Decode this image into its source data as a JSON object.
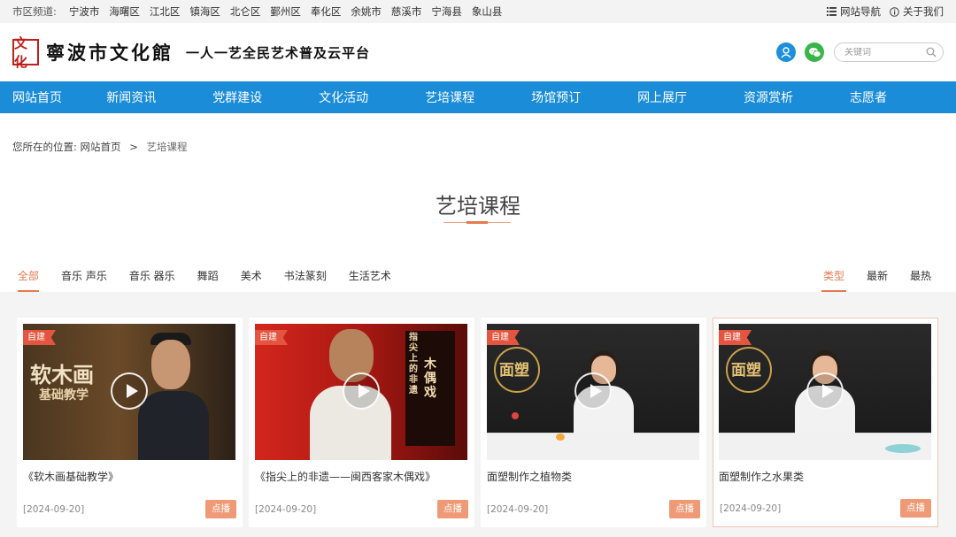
{
  "topbar": {
    "channel_label": "市区频道:",
    "cities": [
      "宁波市",
      "海曙区",
      "江北区",
      "镇海区",
      "北仑区",
      "鄞州区",
      "奉化区",
      "余姚市",
      "慈溪市",
      "宁海县",
      "象山县"
    ],
    "site_nav": "网站导航",
    "about": "关于我们"
  },
  "header": {
    "logo_mark": "文化",
    "logo_name": "寧波市文化館",
    "slogan": "一人一艺全民艺术普及云平台",
    "search_placeholder": "关键词"
  },
  "nav": [
    "网站首页",
    "新闻资讯",
    "党群建设",
    "文化活动",
    "艺培课程",
    "场馆预订",
    "网上展厅",
    "资源赏析",
    "志愿者"
  ],
  "breadcrumb": {
    "prefix": "您所在的位置:",
    "home": "网站首页",
    "separator": ">",
    "current": "艺培课程"
  },
  "page_title": "艺培课程",
  "category_tabs": [
    "全部",
    "音乐 声乐",
    "音乐 器乐",
    "舞蹈",
    "美术",
    "书法篆刻",
    "生活艺术"
  ],
  "sort_tabs": [
    "类型",
    "最新",
    "最热"
  ],
  "cards": [
    {
      "badge": "自建",
      "title": "《软木画基础教学》",
      "date": "[2024-09-20]",
      "button": "点播",
      "thumb_text_1": "软木画",
      "thumb_text_2": "基础教学"
    },
    {
      "badge": "自建",
      "title": "《指尖上的非遗——闽西客家木偶戏》",
      "date": "[2024-09-20]",
      "button": "点播",
      "thumb_text_1": "木偶戏",
      "thumb_text_2": "指尖上的非遗"
    },
    {
      "badge": "自建",
      "title": "面塑制作之植物类",
      "date": "[2024-09-20]",
      "button": "点播",
      "thumb_text_1": "面塑"
    },
    {
      "badge": "自建",
      "title": "面塑制作之水果类",
      "date": "[2024-09-20]",
      "button": "点播",
      "thumb_text_1": "面塑"
    }
  ],
  "colors": {
    "nav_blue": "#1a8cd8",
    "accent_orange": "#e37a52",
    "badge_red": "#e4553f",
    "button_orange": "#ef9a76"
  }
}
